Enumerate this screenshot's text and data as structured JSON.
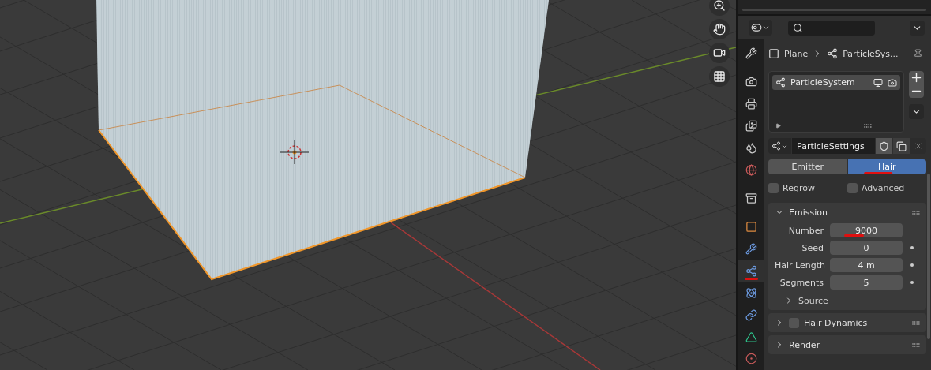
{
  "properties": {
    "breadcrumb": [
      "Plane",
      "ParticleSys..."
    ],
    "tabs": [
      {
        "kind": "tool",
        "selected": false,
        "gap_before": false,
        "underlined": false
      },
      {
        "kind": "render",
        "selected": false,
        "gap_before": true,
        "underlined": false
      },
      {
        "kind": "output",
        "selected": false,
        "gap_before": false,
        "underlined": false
      },
      {
        "kind": "view_layer",
        "selected": false,
        "gap_before": false,
        "underlined": false
      },
      {
        "kind": "scene",
        "selected": false,
        "gap_before": false,
        "underlined": false
      },
      {
        "kind": "world",
        "selected": false,
        "gap_before": false,
        "underlined": false
      },
      {
        "kind": "collection",
        "selected": false,
        "gap_before": true,
        "underlined": false
      },
      {
        "kind": "object",
        "selected": false,
        "gap_before": true,
        "underlined": false
      },
      {
        "kind": "modifier",
        "selected": false,
        "gap_before": false,
        "underlined": false
      },
      {
        "kind": "particles",
        "selected": true,
        "gap_before": false,
        "underlined": true
      },
      {
        "kind": "physics",
        "selected": false,
        "gap_before": false,
        "underlined": false
      },
      {
        "kind": "constraints",
        "selected": false,
        "gap_before": false,
        "underlined": false
      },
      {
        "kind": "data",
        "selected": false,
        "gap_before": false,
        "underlined": false
      },
      {
        "kind": "material",
        "selected": false,
        "gap_before": false,
        "underlined": false
      }
    ],
    "particle_list": [
      {
        "name": "ParticleSystem",
        "selected": true
      }
    ],
    "settings_name": "ParticleSettings",
    "type_toggle": [
      {
        "label": "Emitter",
        "selected": false,
        "underlined": false
      },
      {
        "label": "Hair",
        "selected": true,
        "underlined": true
      }
    ],
    "options": [
      {
        "label": "Regrow",
        "checked": false
      },
      {
        "label": "Advanced",
        "checked": false
      }
    ],
    "panels": [
      {
        "title": "Emission",
        "expanded": true,
        "kind": "plain",
        "fields": [
          {
            "label": "Number",
            "value": "9000",
            "value_underlined": true,
            "keyframe_dot": false
          },
          {
            "label": "Seed",
            "value": "0",
            "value_underlined": false,
            "keyframe_dot": true
          },
          {
            "label": "Hair Length",
            "value": "4 m",
            "value_underlined": false,
            "keyframe_dot": true
          },
          {
            "label": "Segments",
            "value": "5",
            "value_underlined": false,
            "keyframe_dot": true
          }
        ],
        "subpanels": [
          {
            "title": "Source",
            "expanded": false
          }
        ]
      },
      {
        "title": "Hair Dynamics",
        "expanded": false,
        "kind": "checkbox",
        "checked": false
      },
      {
        "title": "Render",
        "expanded": false,
        "kind": "plain"
      }
    ]
  }
}
